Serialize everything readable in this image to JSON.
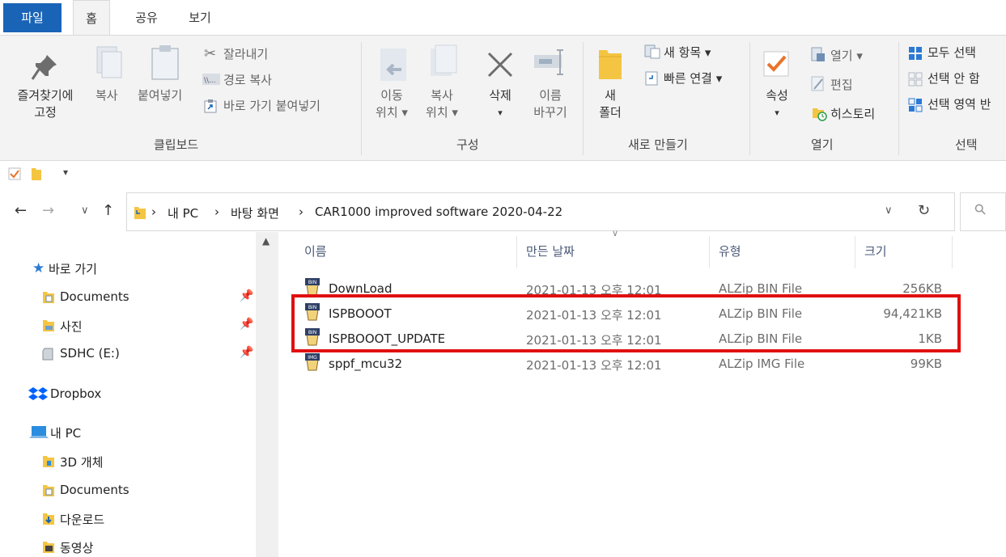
{
  "tabs": {
    "file": "파일",
    "home": "홈",
    "share": "공유",
    "view": "보기"
  },
  "ribbon": {
    "clipboard": {
      "pin_line1": "즐겨찾기에",
      "pin_line2": "고정",
      "copy": "복사",
      "paste": "붙여넣기",
      "cut": "잘라내기",
      "copy_path": "경로 복사",
      "paste_shortcut": "바로 가기 붙여넣기",
      "group": "클립보드"
    },
    "organize": {
      "move_line1": "이동",
      "move_line2": "위치 ▾",
      "copyto_line1": "복사",
      "copyto_line2": "위치 ▾",
      "delete": "삭제",
      "delete_arrow": "▾",
      "rename_line1": "이름",
      "rename_line2": "바꾸기",
      "group": "구성"
    },
    "new": {
      "folder_line1": "새",
      "folder_line2": "폴더",
      "new_item": "새 항목 ▾",
      "easy_access": "빠른 연결 ▾",
      "group": "새로 만들기"
    },
    "open": {
      "properties": "속성",
      "properties_arrow": "▾",
      "open": "열기 ▾",
      "edit": "편집",
      "history": "히스토리",
      "group": "열기"
    },
    "select": {
      "select_all": "모두 선택",
      "select_none": "선택 안 함",
      "invert": "선택 영역 반",
      "group": "선택"
    }
  },
  "quick_access_arrow": "▾",
  "address": {
    "back": "←",
    "forward": "→",
    "recent": "∨",
    "up": "↑",
    "crumb1": "내 PC",
    "crumb2": "바탕 화면",
    "crumb3": "CAR1000 improved software 2020-04-22",
    "sep": "›",
    "dropdown": "∨",
    "refresh": "↻",
    "search_glyph": "⚲"
  },
  "nav": {
    "quick_access": "바로 가기",
    "documents": "Documents",
    "pictures": "사진",
    "sdhc": "SDHC (E:)",
    "dropbox": "Dropbox",
    "this_pc": "내 PC",
    "objects3d": "3D 개체",
    "documents2": "Documents",
    "downloads": "다운로드",
    "videos": "동영상",
    "pin": "📌"
  },
  "columns": {
    "name": "이름",
    "date": "만든 날짜",
    "type": "유형",
    "size": "크기",
    "sort_glyph": "∨"
  },
  "files": [
    {
      "name": "DownLoad",
      "date": "2021-01-13 오후 12:01",
      "type": "ALZip BIN File",
      "size": "256KB",
      "badge": "BIN"
    },
    {
      "name": "ISPBOOOT",
      "date": "2021-01-13 오후 12:01",
      "type": "ALZip BIN File",
      "size": "94,421KB",
      "badge": "BIN"
    },
    {
      "name": "ISPBOOOT_UPDATE",
      "date": "2021-01-13 오후 12:01",
      "type": "ALZip BIN File",
      "size": "1KB",
      "badge": "BIN"
    },
    {
      "name": "sppf_mcu32",
      "date": "2021-01-13 오후 12:01",
      "type": "ALZip IMG File",
      "size": "99KB",
      "badge": "IMG"
    }
  ],
  "colors": {
    "file_tab": "#1a64b7",
    "highlight": "#e01010",
    "folder": "#f4c542"
  }
}
